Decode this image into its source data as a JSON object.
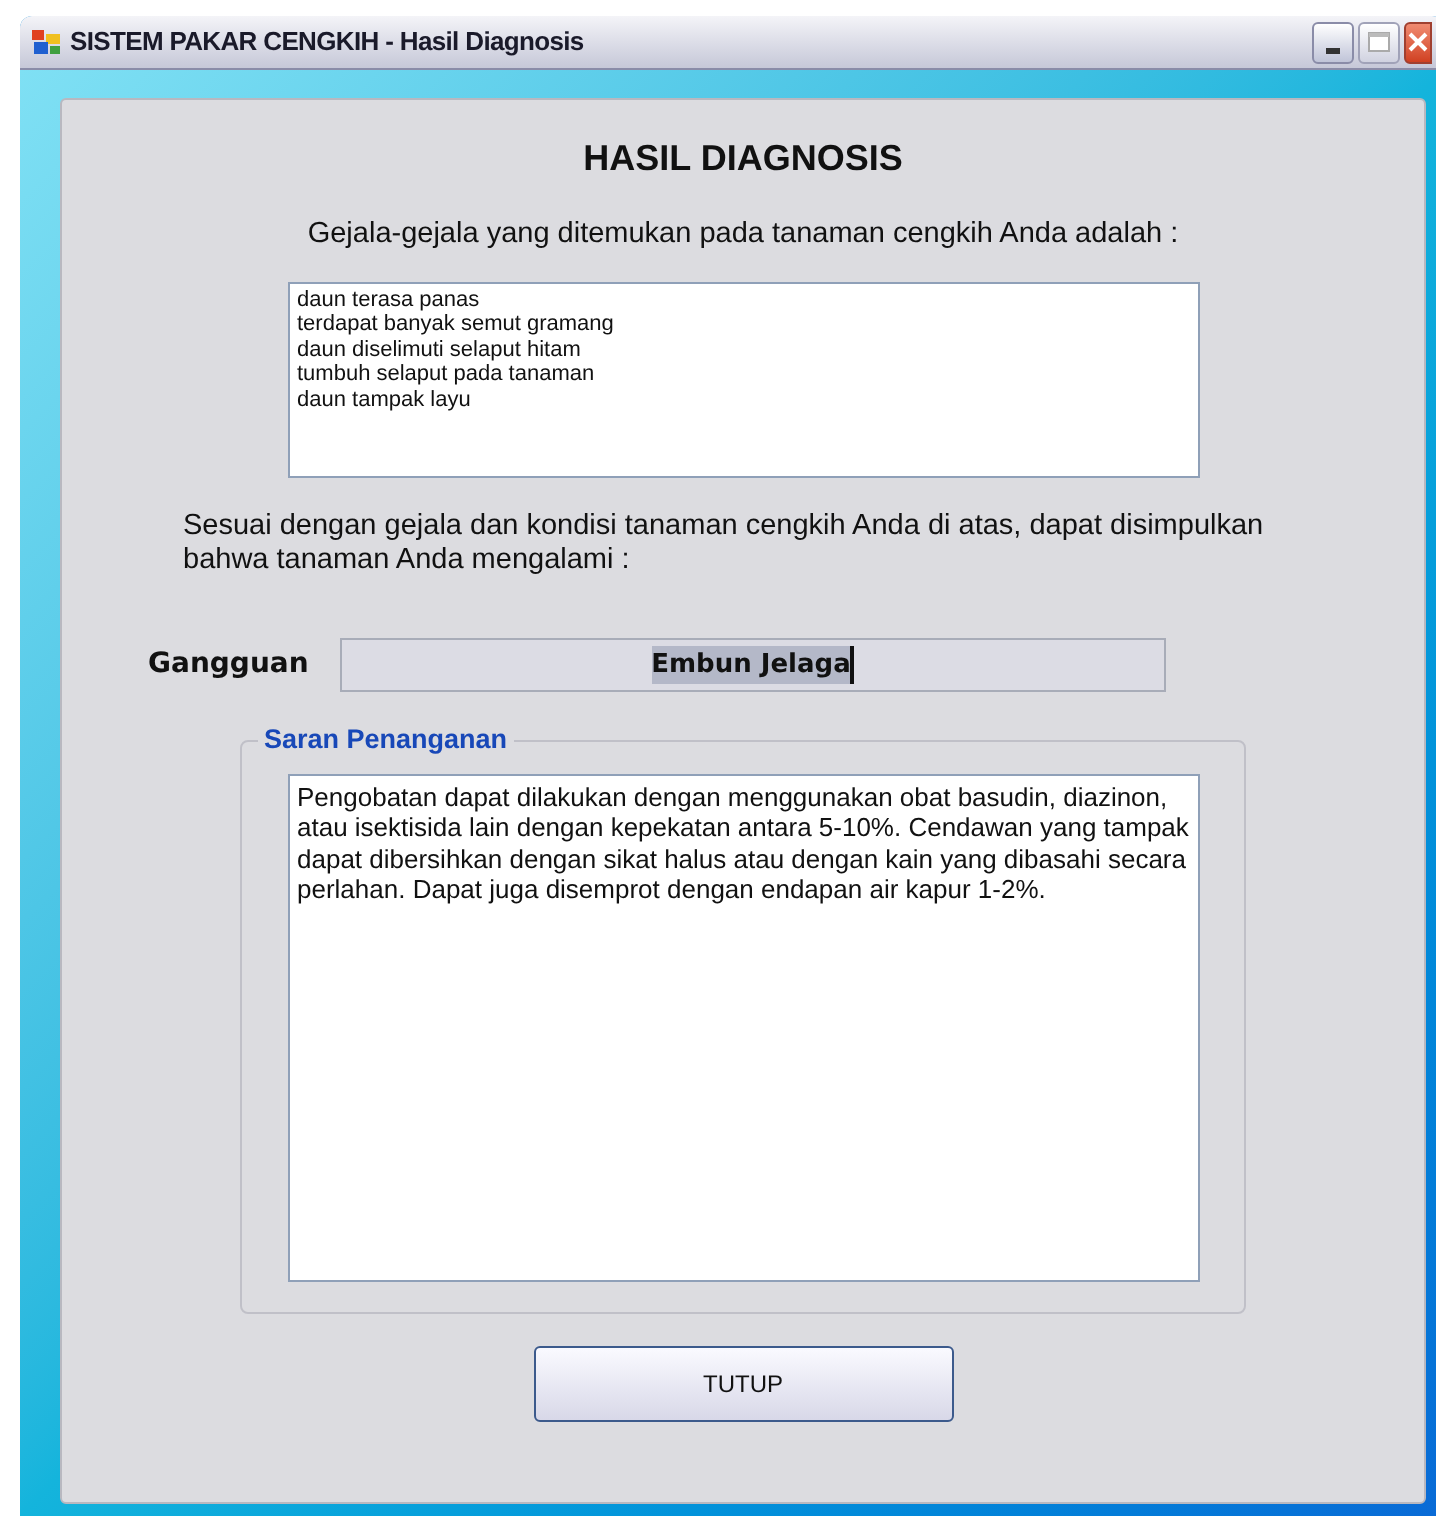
{
  "window": {
    "title": "SISTEM PAKAR CENGKIH - Hasil Diagnosis"
  },
  "heading": "HASIL DIAGNOSIS",
  "symptoms_label": "Gejala-gejala yang ditemukan pada tanaman cengkih Anda adalah :",
  "symptoms": [
    "daun terasa panas",
    "terdapat banyak semut gramang",
    "daun diselimuti selaput hitam",
    "tumbuh selaput pada tanaman",
    "daun tampak layu"
  ],
  "conclusion": "Sesuai dengan gejala dan kondisi tanaman cengkih Anda di atas, dapat disimpulkan bahwa tanaman Anda mengalami :",
  "disorder": {
    "label": "Gangguan",
    "value": "Embun Jelaga",
    "selected": true
  },
  "advice": {
    "title": "Saran Penanganan",
    "text": "Pengobatan dapat dilakukan dengan menggunakan obat basudin, diazinon, atau isektisida lain dengan kepekatan antara 5-10%. Cendawan yang tampak dapat dibersihkan dengan sikat halus atau dengan kain yang dibasahi secara perlahan. Dapat juga disemprot dengan endapan air kapur 1-2%."
  },
  "buttons": [
    "TUTUP"
  ]
}
